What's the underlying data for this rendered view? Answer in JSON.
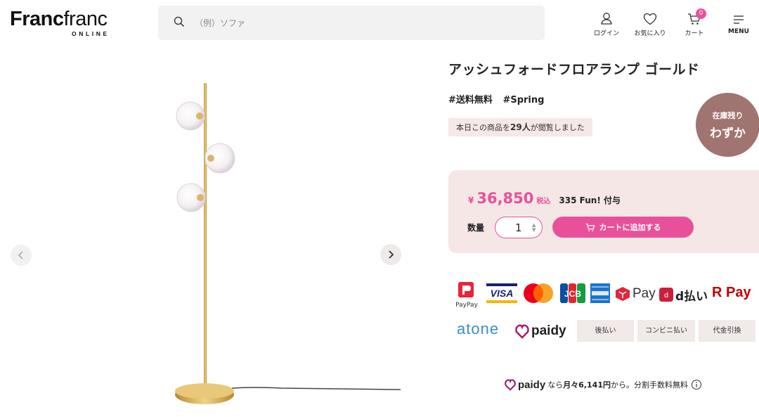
{
  "header": {
    "logo_main_bold": "Franc",
    "logo_main_thin": "franc",
    "logo_sub": "ONLINE",
    "search_placeholder": "（例）ソファ",
    "nav": [
      {
        "label": "ログイン",
        "icon": "user-icon"
      },
      {
        "label": "お気に入り",
        "icon": "heart-icon"
      },
      {
        "label": "カート",
        "icon": "cart-icon",
        "badge": "0"
      },
      {
        "label": "MENU",
        "icon": "menu-icon"
      }
    ]
  },
  "product": {
    "title": "アッシュフォードフロアランプ ゴールド",
    "tags": [
      "#送料無料",
      "#Spring"
    ],
    "viewed_prefix": "本日この商品を",
    "viewed_count": "29人",
    "viewed_suffix": "が閲覧しました",
    "stock_line1": "在庫残り",
    "stock_line2": "わずか"
  },
  "purchase": {
    "currency": "¥",
    "price": "36,850",
    "tax_label": "税込",
    "points": "335 Fun! 付与",
    "qty_label": "数量",
    "qty_value": "1",
    "cart_button": "カートに追加する"
  },
  "payments": {
    "row1": [
      "PayPay",
      "VISA",
      "Mastercard",
      "JCB",
      "American Express",
      "Pay",
      "d払い",
      "R Pay"
    ],
    "paypay_label": "PayPay",
    "visa_label": "VISA",
    "jcb_label": "JCB",
    "merpay_label": "Pay",
    "dpay_label": "d払い",
    "rpay_label": "R Pay",
    "atone_label": "atone",
    "paidy_label": "paidy",
    "boxes": [
      "後払い",
      "コンビニ払い",
      "代金引換"
    ]
  },
  "paidy_promo": {
    "brand": "paidy",
    "text_a": "なら",
    "monthly": "月々6,141円",
    "text_b": "から。分割手数料無料"
  },
  "colors": {
    "accent": "#e8519a",
    "price_panel": "#f4e7e6",
    "stock_badge": "#a07470",
    "lamp_gold": "#c9a24a"
  }
}
